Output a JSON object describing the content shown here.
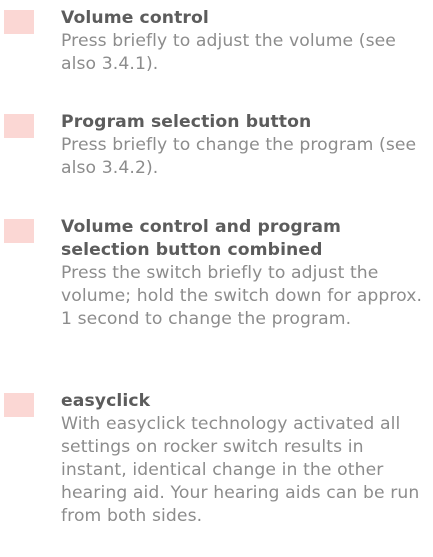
{
  "colors": {
    "swatch": "#fbd7d4",
    "heading": "#5c5c5c",
    "body": "#8c8c8c"
  },
  "items": [
    {
      "heading": "Volume control",
      "body": "Press briefly to adjust the volume (see also 3.4.1)."
    },
    {
      "heading": "Program selection button",
      "body": "Press briefly to change the program (see also 3.4.2)."
    },
    {
      "heading": "Volume control and program selection button combined",
      "body": "Press the switch briefly to adjust the volume; hold the switch down for approx. 1 second to change the program."
    },
    {
      "heading": "easyclick",
      "body": "With easyclick technology activated all settings on rocker switch results in instant, identical change in the other hearing aid. Your hearing aids can be run from both sides."
    }
  ]
}
